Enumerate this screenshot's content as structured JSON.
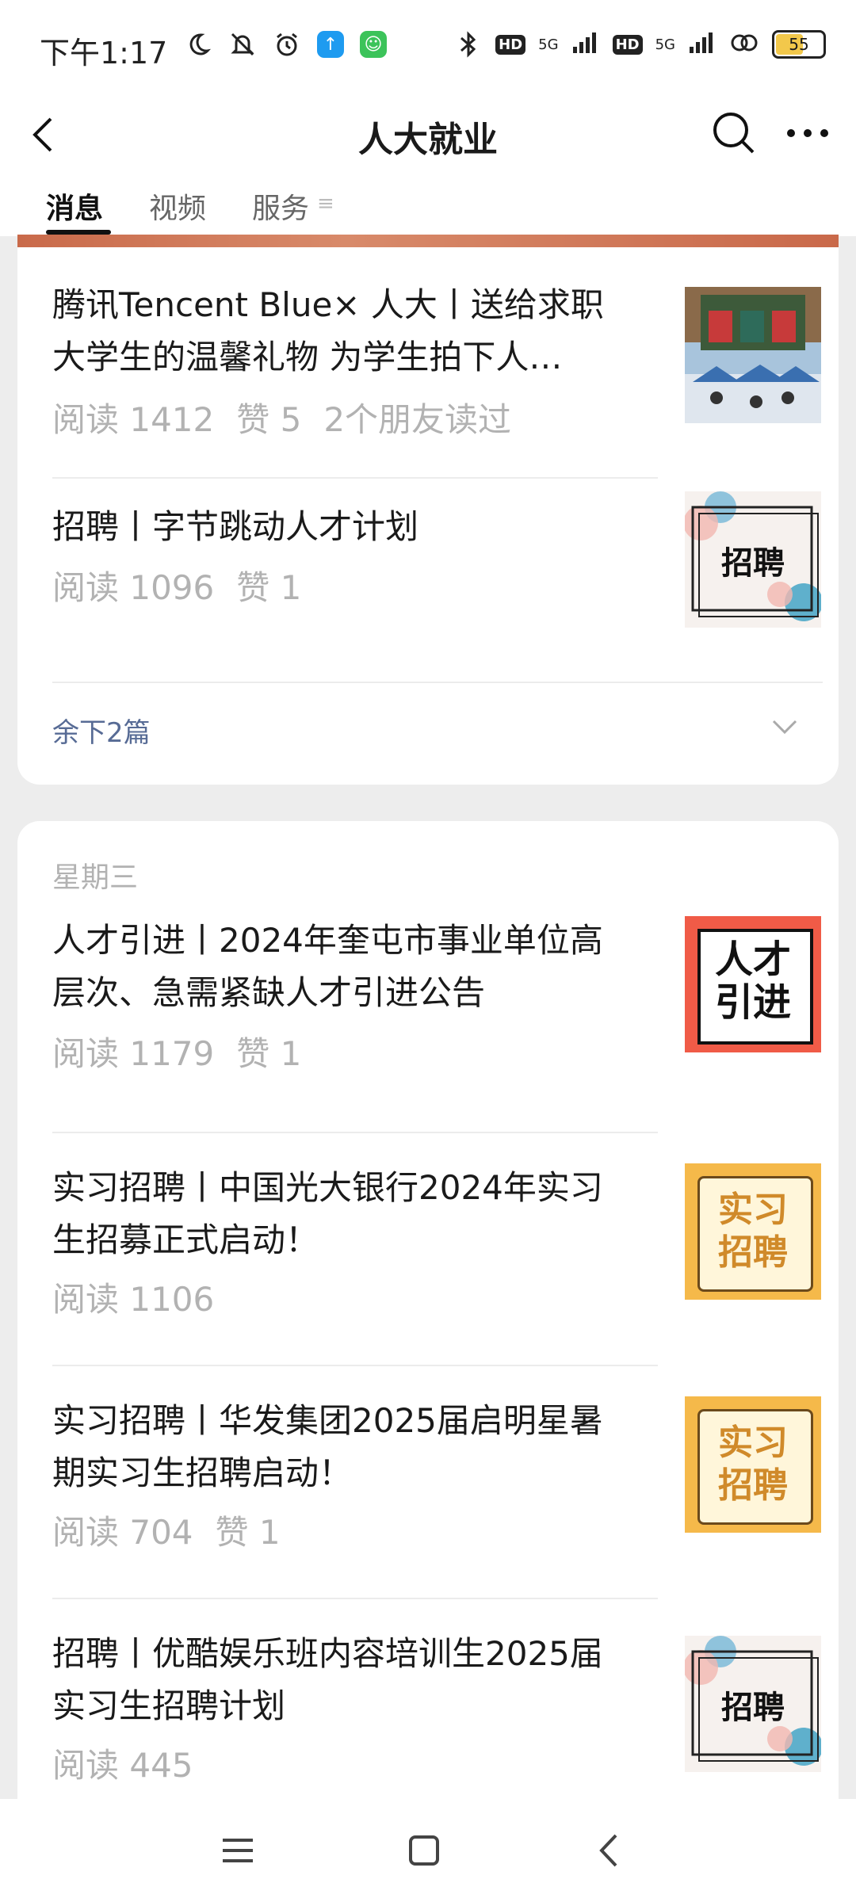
{
  "status_bar": {
    "time": "下午1:17",
    "network_1": "5G",
    "network_2": "5G",
    "hd_label": "HD",
    "battery": "55",
    "battery_color": "#f2c84b"
  },
  "header": {
    "title": "人大就业"
  },
  "tabs": [
    {
      "label": "消息"
    },
    {
      "label": "视频"
    },
    {
      "label": "服务"
    }
  ],
  "tab_more_glyph": "≡",
  "card1": {
    "articles": [
      {
        "title": "腾讯Tencent Blue× 人大丨送给求职大学生的温馨礼物 为学生拍下人…",
        "reads": "阅读 1412",
        "likes": "赞 5",
        "friends": "2个朋友读过"
      },
      {
        "title": "招聘丨字节跳动人才计划",
        "reads": "阅读 1096",
        "likes": "赞 1",
        "thumb_text": "招聘"
      }
    ],
    "more_label": "余下2篇"
  },
  "card2": {
    "day_label": "星期三",
    "articles": [
      {
        "title": "人才引进丨2024年奎屯市事业单位高层次、急需紧缺人才引进公告",
        "reads": "阅读 1179",
        "likes": "赞 1",
        "thumb_line1": "人才",
        "thumb_line2": "引进"
      },
      {
        "title": "实习招聘丨中国光大银行2024年实习生招募正式启动！",
        "reads": "阅读 1106",
        "likes": "",
        "thumb_line1": "实习",
        "thumb_line2": "招聘"
      },
      {
        "title": "实习招聘丨华发集团2025届启明星暑期实习生招聘启动！",
        "reads": "阅读 704",
        "likes": "赞 1",
        "thumb_line1": "实习",
        "thumb_line2": "招聘"
      },
      {
        "title": "招聘丨优酷娱乐班内容培训生2025届实习生招聘计划",
        "reads": "阅读 445",
        "likes": "",
        "thumb_text": "招聘"
      }
    ]
  },
  "colors": {
    "link": "#576b95",
    "meta": "#b2b2b2",
    "background": "#ededed"
  }
}
